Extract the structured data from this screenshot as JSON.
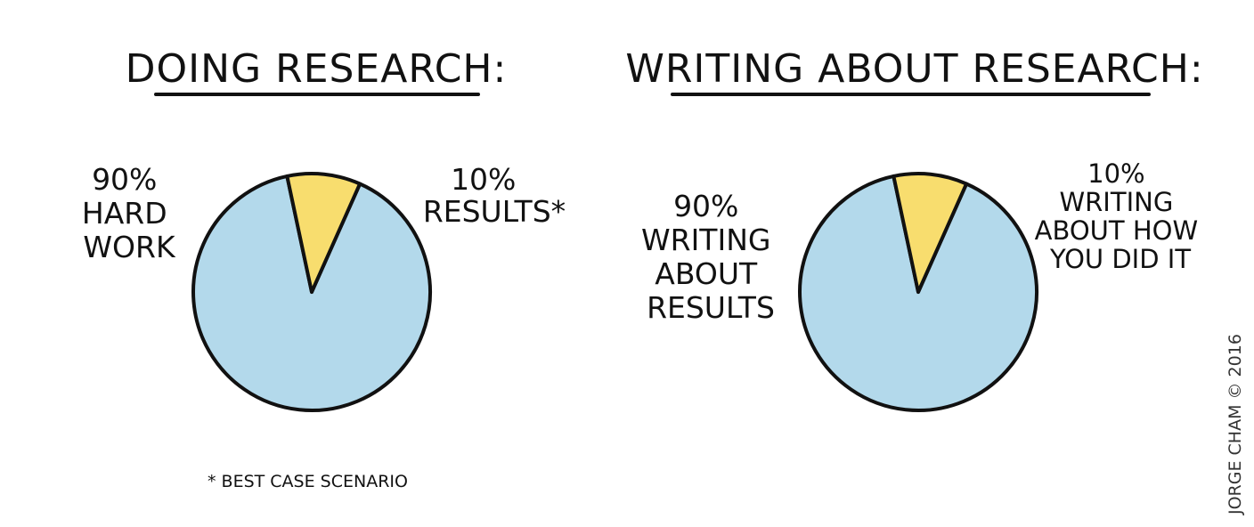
{
  "chart_data": [
    {
      "type": "pie",
      "title": "DOING RESEARCH:",
      "slices": [
        {
          "label_lines": [
            "90%",
            "HARD",
            "WORK"
          ],
          "value": 90,
          "color": "#b3d9eb"
        },
        {
          "label_lines": [
            "10%",
            "RESULTS*"
          ],
          "value": 10,
          "color": "#f8dd6e"
        }
      ]
    },
    {
      "type": "pie",
      "title": "WRITING ABOUT RESEARCH:",
      "slices": [
        {
          "label_lines": [
            "90%",
            "WRITING",
            "ABOUT",
            "RESULTS"
          ],
          "value": 90,
          "color": "#b3d9eb"
        },
        {
          "label_lines": [
            "10%",
            "WRITING",
            "ABOUT HOW",
            "YOU DID IT"
          ],
          "value": 10,
          "color": "#f8dd6e"
        }
      ]
    }
  ],
  "footnote": "* BEST CASE SCENARIO",
  "credit": "JORGE CHAM © 2016",
  "colors": {
    "ink": "#111111",
    "major_slice": "#b3d9eb",
    "minor_slice": "#f8dd6e",
    "background": "#ffffff"
  }
}
